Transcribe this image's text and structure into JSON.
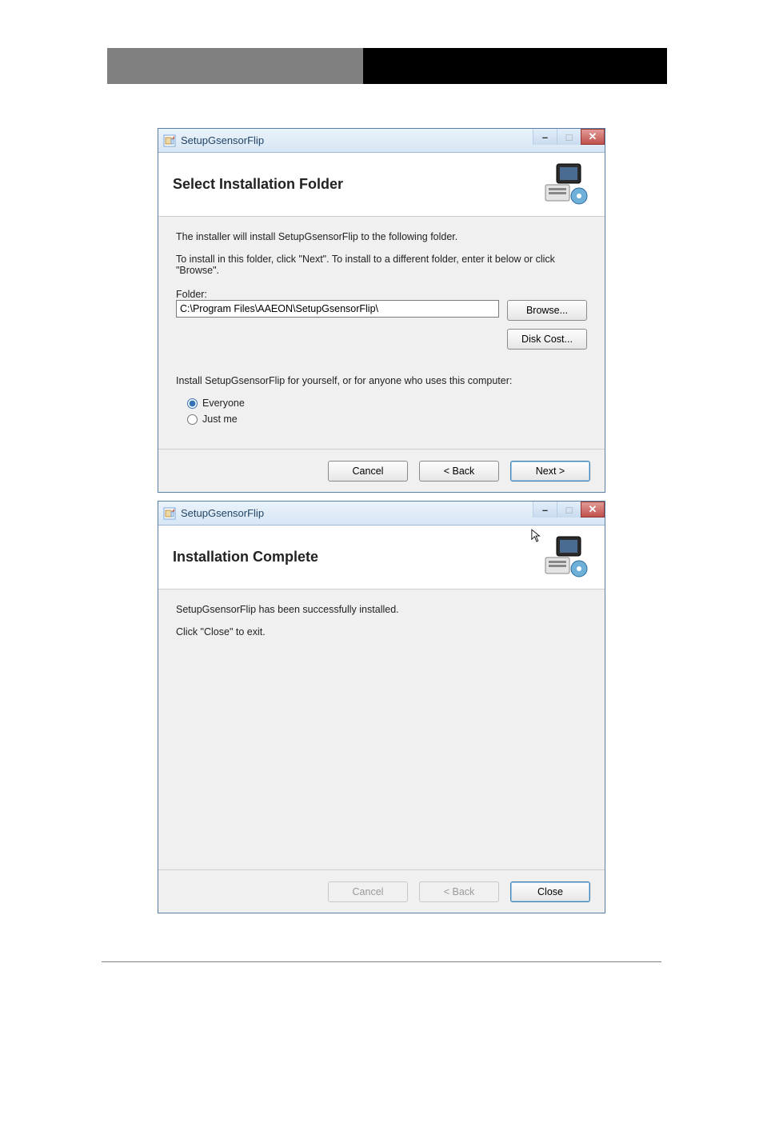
{
  "dialog1": {
    "title": "SetupGsensorFlip",
    "banner_title": "Select Installation Folder",
    "intro1": "The installer will install SetupGsensorFlip to the following folder.",
    "intro2": "To install in this folder, click \"Next\". To install to a different folder, enter it below or click \"Browse\".",
    "folder_label": "Folder:",
    "folder_value": "C:\\Program Files\\AAEON\\SetupGsensorFlip\\",
    "browse_label": "Browse...",
    "disk_cost_label": "Disk Cost...",
    "install_for_prompt": "Install SetupGsensorFlip for yourself, or for anyone who uses this computer:",
    "radio_everyone": "Everyone",
    "radio_justme": "Just me",
    "cancel_label": "Cancel",
    "back_label": "< Back",
    "next_label": "Next >"
  },
  "dialog2": {
    "title": "SetupGsensorFlip",
    "banner_title": "Installation Complete",
    "line1": "SetupGsensorFlip has been successfully installed.",
    "line2": "Click \"Close\" to exit.",
    "cancel_label": "Cancel",
    "back_label": "< Back",
    "close_label": "Close"
  },
  "title_controls": {
    "min": "▬",
    "max": "▣",
    "close": "✕"
  }
}
